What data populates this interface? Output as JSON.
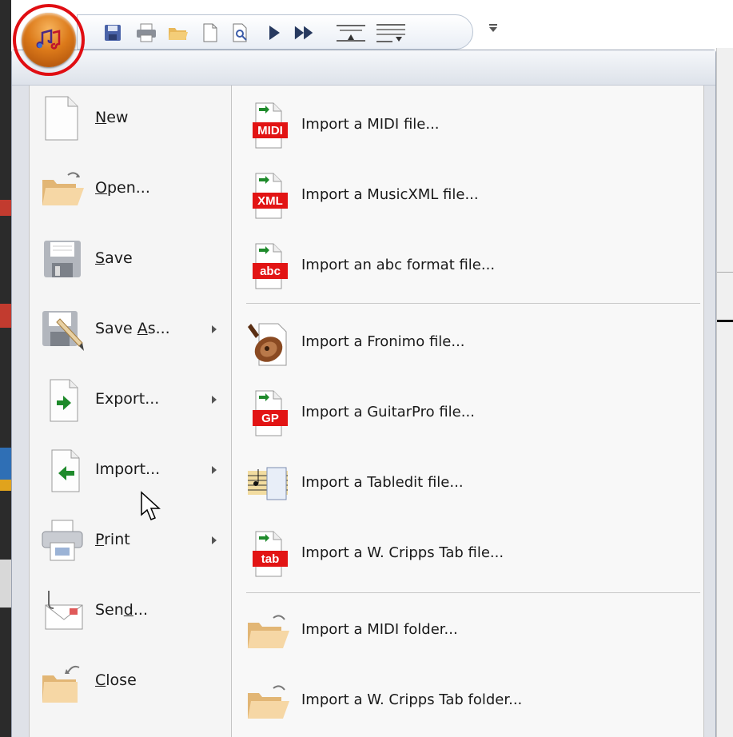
{
  "app": {
    "icon": "music-notes-icon",
    "accent": "#e00d12"
  },
  "quick_access": [
    {
      "name": "save-icon"
    },
    {
      "name": "print-icon"
    },
    {
      "name": "open-icon"
    },
    {
      "name": "new-document-icon"
    },
    {
      "name": "print-preview-icon"
    },
    {
      "name": "play-icon"
    },
    {
      "name": "fast-forward-icon"
    },
    {
      "name": "align-up-icon"
    },
    {
      "name": "align-down-icon"
    }
  ],
  "left_menu": [
    {
      "pre": "",
      "u": "N",
      "post": "ew",
      "icon": "new-document-icon",
      "arrow": false
    },
    {
      "pre": "",
      "u": "O",
      "post": "pen...",
      "icon": "open-folder-icon",
      "arrow": false
    },
    {
      "pre": "",
      "u": "S",
      "post": "ave",
      "icon": "save-disk-icon",
      "arrow": false
    },
    {
      "pre": "Save ",
      "u": "A",
      "post": "s...",
      "icon": "save-as-icon",
      "arrow": true
    },
    {
      "pre": "Export...",
      "u": "",
      "post": "",
      "icon": "export-icon",
      "arrow": true
    },
    {
      "pre": "Import...",
      "u": "",
      "post": "",
      "icon": "import-icon",
      "arrow": true
    },
    {
      "pre": "",
      "u": "P",
      "post": "rint",
      "icon": "printer-icon",
      "arrow": true
    },
    {
      "pre": "Sen",
      "u": "d",
      "post": "...",
      "icon": "send-mail-icon",
      "arrow": false
    },
    {
      "pre": "",
      "u": "C",
      "post": "lose",
      "icon": "close-folder-icon",
      "arrow": false
    }
  ],
  "right_menu": [
    {
      "label": "Import a MIDI file...",
      "badge": "MIDI",
      "icon": "midi-file-icon"
    },
    {
      "label": "Import a MusicXML file...",
      "badge": "XML",
      "icon": "musicxml-file-icon"
    },
    {
      "label": "Import an abc format file...",
      "badge": "abc",
      "icon": "abc-file-icon"
    },
    {
      "label": "Import a Fronimo file...",
      "badge": "",
      "icon": "lute-icon"
    },
    {
      "label": "Import a GuitarPro file...",
      "badge": "GP",
      "icon": "guitarpro-file-icon"
    },
    {
      "label": "Import a Tabledit file...",
      "badge": "",
      "icon": "tabledit-icon"
    },
    {
      "label": "Import a W. Cripps Tab file...",
      "badge": "tab",
      "icon": "tab-file-icon"
    },
    {
      "label": "Import a MIDI folder...",
      "badge": "",
      "icon": "folder-icon"
    },
    {
      "label": "Import a W. Cripps Tab folder...",
      "badge": "",
      "icon": "folder-icon"
    }
  ]
}
